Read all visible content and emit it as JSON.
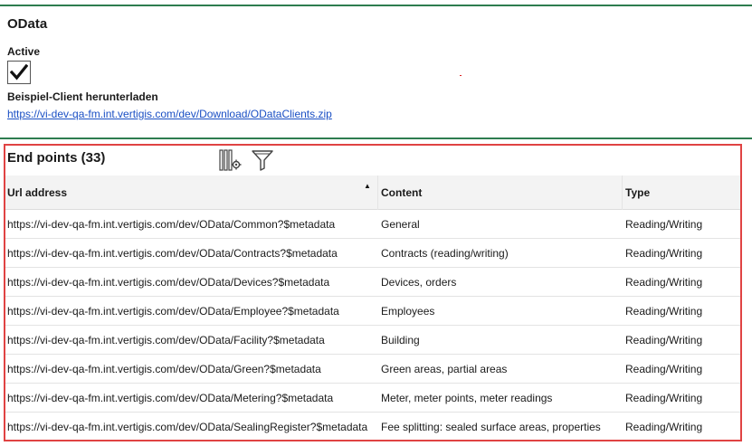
{
  "header": {
    "title": "OData",
    "active_label": "Active",
    "active_checked": true,
    "download_label": "Beispiel-Client herunterladen",
    "download_link": "https://vi-dev-qa-fm.int.vertigis.com/dev/Download/ODataClients.zip"
  },
  "endpoints": {
    "title": "End points (33)",
    "toolbar_icons": [
      "columns-settings-icon",
      "filter-icon"
    ],
    "columns": {
      "url": "Url address",
      "content": "Content",
      "type": "Type"
    },
    "sort": {
      "column": "url",
      "direction": "ascending"
    },
    "rows": [
      {
        "url": "https://vi-dev-qa-fm.int.vertigis.com/dev/OData/Common?$metadata",
        "content": "General",
        "type": "Reading/Writing"
      },
      {
        "url": "https://vi-dev-qa-fm.int.vertigis.com/dev/OData/Contracts?$metadata",
        "content": "Contracts (reading/writing)",
        "type": "Reading/Writing"
      },
      {
        "url": "https://vi-dev-qa-fm.int.vertigis.com/dev/OData/Devices?$metadata",
        "content": "Devices, orders",
        "type": "Reading/Writing"
      },
      {
        "url": "https://vi-dev-qa-fm.int.vertigis.com/dev/OData/Employee?$metadata",
        "content": "Employees",
        "type": "Reading/Writing"
      },
      {
        "url": "https://vi-dev-qa-fm.int.vertigis.com/dev/OData/Facility?$metadata",
        "content": "Building",
        "type": "Reading/Writing"
      },
      {
        "url": "https://vi-dev-qa-fm.int.vertigis.com/dev/OData/Green?$metadata",
        "content": "Green areas, partial areas",
        "type": "Reading/Writing"
      },
      {
        "url": "https://vi-dev-qa-fm.int.vertigis.com/dev/OData/Metering?$metadata",
        "content": "Meter, meter points, meter readings",
        "type": "Reading/Writing"
      },
      {
        "url": "https://vi-dev-qa-fm.int.vertigis.com/dev/OData/SealingRegister?$metadata",
        "content": "Fee splitting: sealed surface areas, properties",
        "type": "Reading/Writing"
      }
    ]
  },
  "colors": {
    "rule": "#2e7d4f",
    "highlight_border": "#e04343",
    "link": "#1a4fc4",
    "header_bg": "#f3f3f3"
  }
}
